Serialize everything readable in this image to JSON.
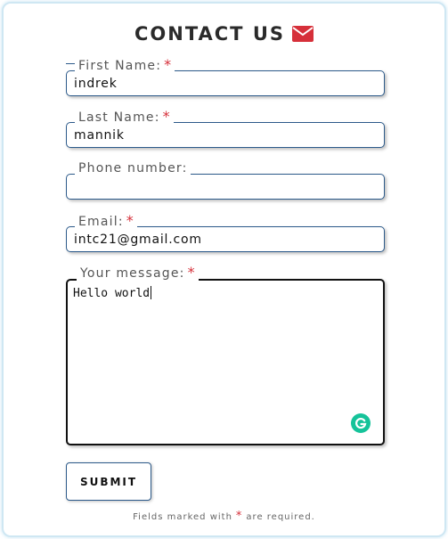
{
  "form": {
    "title": "CONTACT US",
    "title_icon": "envelope-icon",
    "fields": [
      {
        "label": "First Name:",
        "required": true,
        "value": "indrek"
      },
      {
        "label": "Last Name:",
        "required": true,
        "value": "mannik"
      },
      {
        "label": "Phone number:",
        "required": false,
        "value": ""
      },
      {
        "label": "Email:",
        "required": true,
        "value": "intc21@gmail.com"
      }
    ],
    "message": {
      "label": "Your message:",
      "required": true,
      "value": "Hello world"
    },
    "required_mark": "*",
    "submit_label": "SUBMIT",
    "footnote_before": "Fields marked with",
    "footnote_after": "are required."
  },
  "colors": {
    "accent_red": "#d6303a",
    "field_border": "#2c5a8a",
    "card_border": "#cfe7f3",
    "grammarly_green": "#15c39a"
  },
  "icons": {
    "grammarly": "grammarly-icon"
  }
}
